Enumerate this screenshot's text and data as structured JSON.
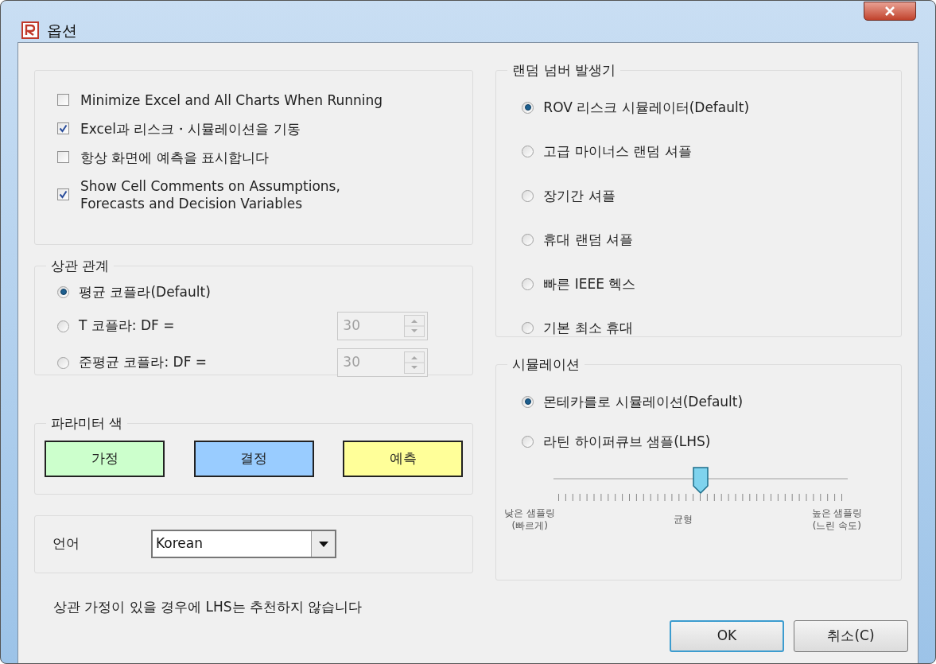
{
  "window": {
    "title": "옵션"
  },
  "options": [
    {
      "label": "Minimize Excel and All Charts When Running",
      "checked": false
    },
    {
      "label": "Excel과 리스크・시뮬레이션을 기동",
      "checked": true
    },
    {
      "label": "항상 화면에 예측을 표시합니다",
      "checked": false
    },
    {
      "label": "Show Cell Comments on Assumptions,\nForecasts and Decision Variables",
      "checked": true
    }
  ],
  "correlation": {
    "title": "상관 관계",
    "items": [
      {
        "label": "평균 코플라(Default)",
        "selected": true
      },
      {
        "label": "T 코플라: DF =",
        "selected": false,
        "df": {
          "value": "30",
          "disabled": true
        }
      },
      {
        "label": "준평균 코플라: DF =",
        "selected": false,
        "df": {
          "value": "30",
          "disabled": true
        }
      }
    ]
  },
  "parameter_colors": {
    "title": "파라미터 색",
    "items": [
      {
        "label": "가정",
        "color": "#ccffcc"
      },
      {
        "label": "결정",
        "color": "#99ccff"
      },
      {
        "label": "예측",
        "color": "#ffff99"
      }
    ]
  },
  "language": {
    "label": "언어",
    "value": "Korean"
  },
  "note": "상관 가정이 있을 경우에 LHS는 추천하지 않습니다",
  "random_number_generator": {
    "title": "랜덤 넘버 발생기",
    "items": [
      {
        "label": "ROV 리스크 시뮬레이터(Default)",
        "selected": true
      },
      {
        "label": "고급 마이너스 랜덤 셔플",
        "selected": false
      },
      {
        "label": "장기간 셔플",
        "selected": false
      },
      {
        "label": "휴대 랜덤 셔플",
        "selected": false
      },
      {
        "label": "빠른 IEEE 헥스",
        "selected": false
      },
      {
        "label": "기본 최소 휴대",
        "selected": false
      }
    ]
  },
  "simulation": {
    "title": "시뮬레이션",
    "items": [
      {
        "label": "몬테카를로 시뮬레이션(Default)",
        "selected": true
      },
      {
        "label": "라틴 하이퍼큐브 샘플(LHS)",
        "selected": false
      }
    ],
    "slider": {
      "level": 0.5,
      "labels": [
        "낮은 샘플링\n(빠르게)",
        "균형",
        "높은 샘플링\n(느린 속도)"
      ]
    }
  },
  "buttons": [
    {
      "label": "OK",
      "default": true
    },
    {
      "label": "취소(C)",
      "default": false
    }
  ]
}
